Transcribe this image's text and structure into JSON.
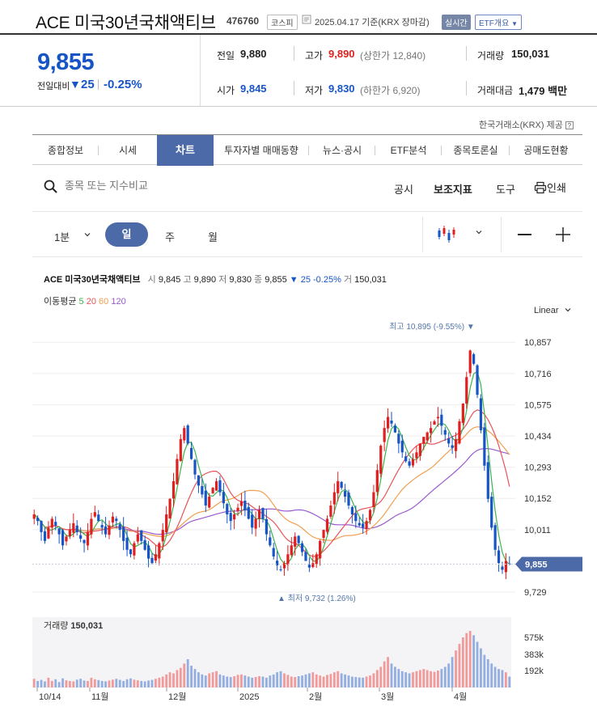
{
  "header": {
    "title": "ACE 미국30년국채액티브",
    "code": "476760",
    "market_badge": "코스피",
    "date_text": "2025.04.17 기준(KRX 장마감)",
    "realtime_badge": "실시간",
    "etf_info": "ETF개요"
  },
  "price": {
    "current": "9,855",
    "change_label": "전일대비",
    "change_arrow": "▼",
    "change_value": "25",
    "change_pct": "-0.25%"
  },
  "summary": {
    "prev_label": "전일",
    "prev_value": "9,880",
    "high_label": "고가",
    "high_value": "9,890",
    "upper_limit": "(상한가 12,840)",
    "volume_label": "거래량",
    "volume_value": "150,031",
    "open_label": "시가",
    "open_value": "9,845",
    "low_label": "저가",
    "low_value": "9,830",
    "lower_limit": "(하한가 6,920)",
    "amount_label": "거래대금",
    "amount_value": "1,479 백만"
  },
  "provider": "한국거래소(KRX) 제공",
  "tabs": [
    {
      "label": "종합정보"
    },
    {
      "label": "시세"
    },
    {
      "label": "차트"
    },
    {
      "label": "투자자별 매매동향"
    },
    {
      "label": "뉴스·공시"
    },
    {
      "label": "ETF분석"
    },
    {
      "label": "종목토론실"
    },
    {
      "label": "공매도현황"
    }
  ],
  "search": {
    "placeholder": "종목 또는 지수비교"
  },
  "tools": {
    "disclosure": "공시",
    "indicator": "보조지표",
    "tool": "도구",
    "print": "인쇄"
  },
  "periods": {
    "minute": "1분",
    "day": "일",
    "week": "주",
    "month": "월"
  },
  "info": {
    "name": "ACE 미국30년국채액티브",
    "open_l": "시",
    "open_v": "9,845",
    "high_l": "고",
    "high_v": "9,890",
    "low_l": "저",
    "low_v": "9,830",
    "close_l": "종",
    "close_v": "9,855",
    "chg": "▼ 25 -0.25%",
    "vol_l": "거",
    "vol_v": "150,031",
    "ma_label": "이동평균",
    "ma5": "5",
    "ma20": "20",
    "ma60": "60",
    "ma120": "120"
  },
  "scale_mode": "Linear",
  "colors": {
    "up": "#e02020",
    "down": "#1755c7",
    "accent": "#4d6aa8",
    "ma5": "#3cb44b",
    "ma20": "#e8545a",
    "ma60": "#f0a050",
    "ma120": "#9b59d0"
  },
  "chart_data": {
    "type": "candlestick",
    "y_ticks": [
      "10,857",
      "10,716",
      "10,575",
      "10,434",
      "10,293",
      "10,152",
      "10,011",
      "9,729"
    ],
    "ylim": [
      9700,
      10960
    ],
    "x_ticks": [
      "10/14",
      "11월",
      "12월",
      "2025",
      "2월",
      "3월",
      "4월"
    ],
    "current_price_label": "9,855",
    "current_price": 9855,
    "max_annotation": "최고 10,895 (-9.55%)",
    "max_value": 10895,
    "min_annotation": "최저 9,732 (1.26%)",
    "min_value": 9732,
    "close_series": [
      10080,
      10050,
      10000,
      9960,
      10020,
      10060,
      10030,
      9990,
      9940,
      9980,
      10010,
      10040,
      10000,
      9970,
      9950,
      10000,
      10060,
      10090,
      10050,
      10020,
      9990,
      10030,
      10070,
      10050,
      10010,
      9960,
      9920,
      9900,
      9950,
      9990,
      9960,
      9920,
      9880,
      9860,
      9900,
      9950,
      10010,
      10080,
      10150,
      10230,
      10330,
      10420,
      10470,
      10400,
      10330,
      10260,
      10210,
      10170,
      10120,
      10160,
      10200,
      10230,
      10180,
      10130,
      10080,
      10050,
      10080,
      10110,
      10140,
      10100,
      10060,
      10020,
      10060,
      10100,
      10060,
      9990,
      9940,
      9890,
      9850,
      9830,
      9860,
      9900,
      9940,
      9980,
      9950,
      9910,
      9870,
      9840,
      9860,
      9900,
      9960,
      10010,
      10060,
      10120,
      10180,
      10230,
      10200,
      10160,
      10120,
      10080,
      10050,
      10030,
      10020,
      10050,
      10100,
      10180,
      10280,
      10390,
      10470,
      10520,
      10490,
      10450,
      10400,
      10360,
      10320,
      10300,
      10330,
      10360,
      10400,
      10430,
      10450,
      10470,
      10500,
      10520,
      10480,
      10440,
      10400,
      10380,
      10420,
      10500,
      10580,
      10700,
      10820,
      10760,
      10620,
      10460,
      10300,
      10150,
      10020,
      9920,
      9860,
      9830,
      9870,
      9855
    ],
    "volume_ticks": [
      "575k",
      "383k",
      "192k"
    ],
    "volume_label": "거래량",
    "volume_value": "150,031",
    "volume_series": [
      40,
      30,
      35,
      28,
      45,
      30,
      38,
      25,
      42,
      33,
      30,
      28,
      36,
      40,
      32,
      30,
      45,
      38,
      34,
      30,
      28,
      32,
      36,
      40,
      35,
      30,
      38,
      42,
      36,
      33,
      30,
      28,
      32,
      35,
      40,
      45,
      50,
      60,
      70,
      65,
      80,
      90,
      110,
      130,
      100,
      85,
      70,
      60,
      55,
      65,
      70,
      75,
      60,
      55,
      50,
      48,
      52,
      58,
      60,
      55,
      50,
      45,
      48,
      52,
      50,
      45,
      55,
      60,
      70,
      75,
      65,
      58,
      50,
      48,
      52,
      55,
      60,
      65,
      70,
      60,
      55,
      50,
      58,
      62,
      70,
      75,
      65,
      60,
      55,
      50,
      48,
      46,
      45,
      50,
      55,
      65,
      80,
      95,
      120,
      140,
      110,
      95,
      85,
      75,
      70,
      65,
      70,
      75,
      80,
      85,
      80,
      75,
      72,
      78,
      85,
      95,
      110,
      140,
      170,
      200,
      230,
      250,
      260,
      240,
      210,
      180,
      150,
      130,
      110,
      95,
      85,
      80,
      70,
      50
    ]
  }
}
